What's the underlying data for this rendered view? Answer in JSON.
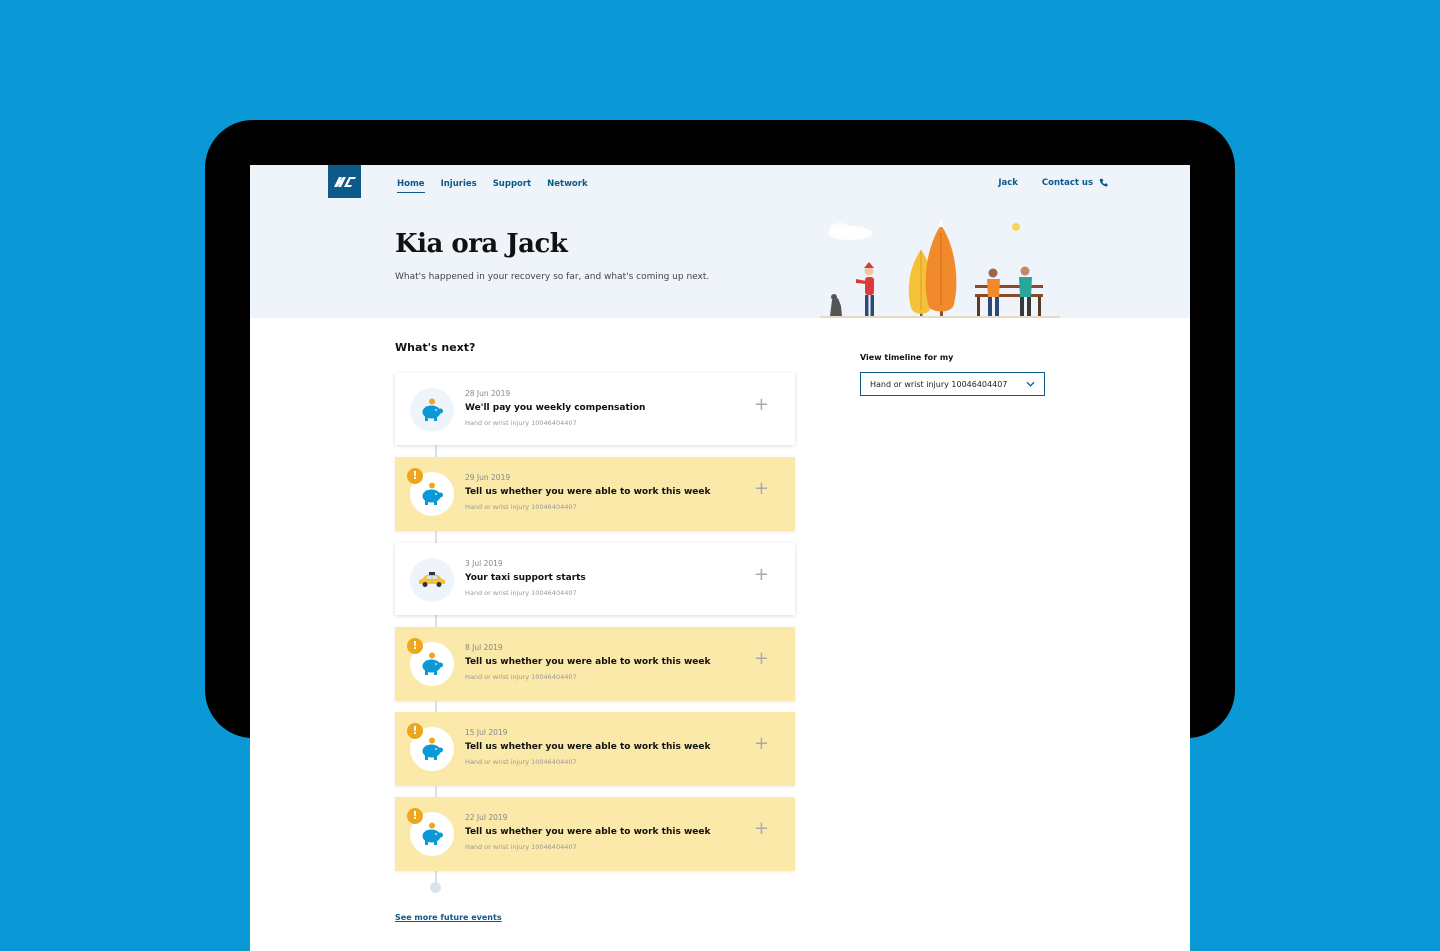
{
  "brand": {
    "logo_text": "ACC",
    "accent": "#0b5a8a",
    "background": "#0a99d6"
  },
  "nav": {
    "items": [
      {
        "label": "Home",
        "active": true
      },
      {
        "label": "Injuries"
      },
      {
        "label": "Support"
      },
      {
        "label": "Network"
      }
    ]
  },
  "utility": {
    "user": "Jack",
    "contact": "Contact us",
    "contact_icon": "phone-icon"
  },
  "hero": {
    "title": "Kia ora Jack",
    "subtitle": "What's happened in your recovery so far, and what's coming up next."
  },
  "whats_next": {
    "title": "What's next?",
    "events": [
      {
        "date": "28 Jun 2019",
        "title": "We'll pay you weekly compensation",
        "injury": "Hand or wrist injury 10046404407",
        "type": "info",
        "icon": "piggy-bank-icon"
      },
      {
        "date": "29 Jun 2019",
        "title": "Tell us whether you were able to work this week",
        "injury": "Hand or wrist injury 10046404407",
        "type": "alert",
        "icon": "piggy-bank-icon"
      },
      {
        "date": "3 Jul 2019",
        "title": "Your taxi support starts",
        "injury": "Hand or wrist injury 10046404407",
        "type": "info",
        "icon": "taxi-icon"
      },
      {
        "date": "8 Jul 2019",
        "title": "Tell us whether you were able to work this week",
        "injury": "Hand or wrist injury 10046404407",
        "type": "alert",
        "icon": "piggy-bank-icon"
      },
      {
        "date": "15 Jul 2019",
        "title": "Tell us whether you were able to work this week",
        "injury": "Hand or wrist injury 10046404407",
        "type": "alert",
        "icon": "piggy-bank-icon"
      },
      {
        "date": "22 Jul 2019",
        "title": "Tell us whether you were able to work this week",
        "injury": "Hand or wrist injury 10046404407",
        "type": "alert",
        "icon": "piggy-bank-icon"
      }
    ],
    "see_more": "See more future events"
  },
  "sidebar": {
    "label": "View timeline for my",
    "selected": "Hand or wrist injury 10046404407"
  }
}
